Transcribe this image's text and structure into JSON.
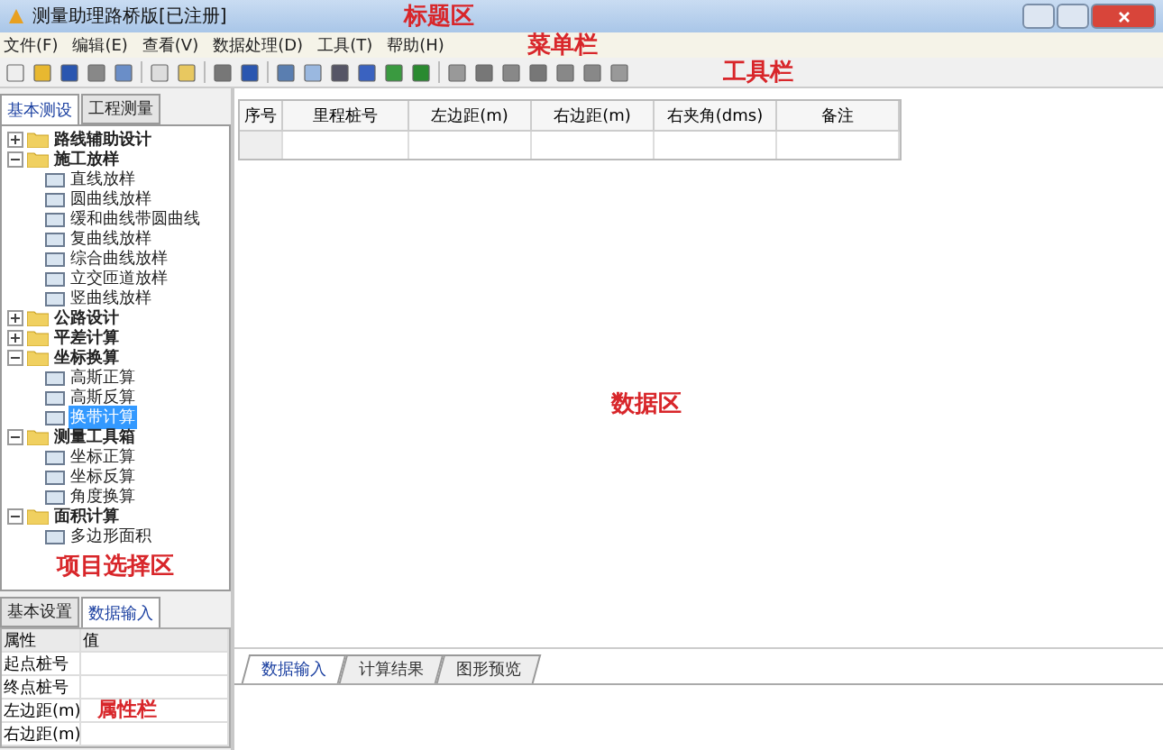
{
  "window": {
    "title": "测量助理路桥版[已注册]",
    "annotation": "标题区"
  },
  "menu_bar": {
    "items": [
      "文件(F)",
      "编辑(E)",
      "查看(V)",
      "数据处理(D)",
      "工具(T)",
      "帮助(H)"
    ],
    "annotation": "菜单栏"
  },
  "toolbar": {
    "annotation": "工具栏"
  },
  "project_panel": {
    "tabs": [
      {
        "label": "基本测设",
        "selected": true
      },
      {
        "label": "工程测量",
        "selected": false
      }
    ],
    "tree": [
      {
        "label": "路线辅助设计",
        "expanded": false
      },
      {
        "label": "施工放样",
        "expanded": true,
        "children": [
          {
            "label": "直线放样",
            "selected": false
          },
          {
            "label": "圆曲线放样",
            "selected": false
          },
          {
            "label": "缓和曲线带圆曲线",
            "selected": false
          },
          {
            "label": "复曲线放样",
            "selected": false
          },
          {
            "label": "综合曲线放样",
            "selected": false
          },
          {
            "label": "立交匝道放样",
            "selected": false
          },
          {
            "label": "竖曲线放样",
            "selected": false
          }
        ]
      },
      {
        "label": "公路设计",
        "expanded": false
      },
      {
        "label": "平差计算",
        "expanded": false
      },
      {
        "label": "坐标换算",
        "expanded": true,
        "children": [
          {
            "label": "高斯正算",
            "selected": false
          },
          {
            "label": "高斯反算",
            "selected": false
          },
          {
            "label": "换带计算",
            "selected": true
          }
        ]
      },
      {
        "label": "测量工具箱",
        "expanded": true,
        "children": [
          {
            "label": "坐标正算",
            "selected": false
          },
          {
            "label": "坐标反算",
            "selected": false
          },
          {
            "label": "角度换算",
            "selected": false
          }
        ]
      },
      {
        "label": "面积计算",
        "expanded": true,
        "children": [
          {
            "label": "多边形面积",
            "selected": false
          }
        ]
      }
    ],
    "annotation": "项目选择区"
  },
  "property_panel": {
    "tabs": [
      {
        "label": "基本设置",
        "selected": false
      },
      {
        "label": "数据输入",
        "selected": true
      }
    ],
    "columns": [
      "属性",
      "值"
    ],
    "rows": [
      "起点桩号",
      "终点桩号",
      "左边距(m)",
      "右边距(m)"
    ],
    "annotation": "属性栏"
  },
  "data_table": {
    "columns": [
      "序号",
      "里程桩号",
      "左边距(m)",
      "右边距(m)",
      "右夹角(dms)",
      "备注"
    ],
    "annotation": "数据区"
  },
  "output_panel": {
    "tabs": [
      {
        "label": "数据输入",
        "selected": true
      },
      {
        "label": "计算结果",
        "selected": false
      },
      {
        "label": "图形预览",
        "selected": false
      }
    ]
  }
}
